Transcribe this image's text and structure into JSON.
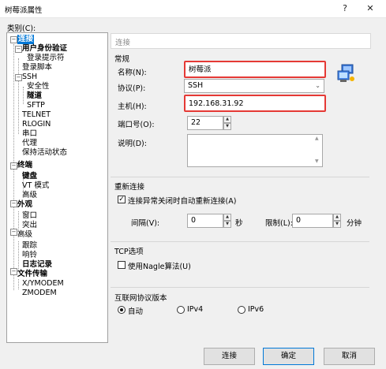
{
  "window": {
    "title": "树莓派属性",
    "help_label": "?",
    "close_label": "✕"
  },
  "category_label": "类别(C):",
  "tree": {
    "items": [
      {
        "label": "连接",
        "bold": true,
        "selected": true
      },
      {
        "label": "用户身份验证",
        "bold": true
      },
      {
        "label": "登录提示符"
      },
      {
        "label": "登录脚本"
      },
      {
        "label": "SSH"
      },
      {
        "label": "安全性"
      },
      {
        "label": "隧道",
        "bold": true
      },
      {
        "label": "SFTP"
      },
      {
        "label": "TELNET"
      },
      {
        "label": "RLOGIN"
      },
      {
        "label": "串口"
      },
      {
        "label": "代理"
      },
      {
        "label": "保持活动状态"
      },
      {
        "label": "终端",
        "bold": true
      },
      {
        "label": "键盘",
        "bold": true
      },
      {
        "label": "VT 模式"
      },
      {
        "label": "高级"
      },
      {
        "label": "外观",
        "bold": true
      },
      {
        "label": "窗口"
      },
      {
        "label": "突出"
      },
      {
        "label": "高级"
      },
      {
        "label": "跟踪"
      },
      {
        "label": "响铃"
      },
      {
        "label": "日志记录",
        "bold": true
      },
      {
        "label": "文件传输",
        "bold": true
      },
      {
        "label": "X/YMODEM"
      },
      {
        "label": "ZMODEM"
      }
    ]
  },
  "panel": {
    "header": "连接",
    "general": {
      "title": "常规",
      "name_label": "名称(N):",
      "name_value": "树莓派",
      "protocol_label": "协议(P):",
      "protocol_value": "SSH",
      "host_label": "主机(H):",
      "host_value": "192.168.31.92",
      "port_label": "端口号(O):",
      "port_value": "22",
      "desc_label": "说明(D):",
      "desc_value": ""
    },
    "reconnect": {
      "title": "重新连接",
      "checkbox_label": "连接异常关闭时自动重新连接(A)",
      "checked": true,
      "interval_label": "间隔(V):",
      "interval_value": "0",
      "interval_unit": "秒",
      "limit_label": "限制(L):",
      "limit_value": "0",
      "limit_unit": "分钟"
    },
    "tcp": {
      "title": "TCP选项",
      "nagle_label": "使用Nagle算法(U)",
      "checked": false
    },
    "ipver": {
      "title": "互联网协议版本",
      "options": [
        "自动",
        "IPv4",
        "IPv6"
      ],
      "selected": "自动"
    }
  },
  "buttons": {
    "connect": "连接",
    "ok": "确定",
    "cancel": "取消"
  }
}
